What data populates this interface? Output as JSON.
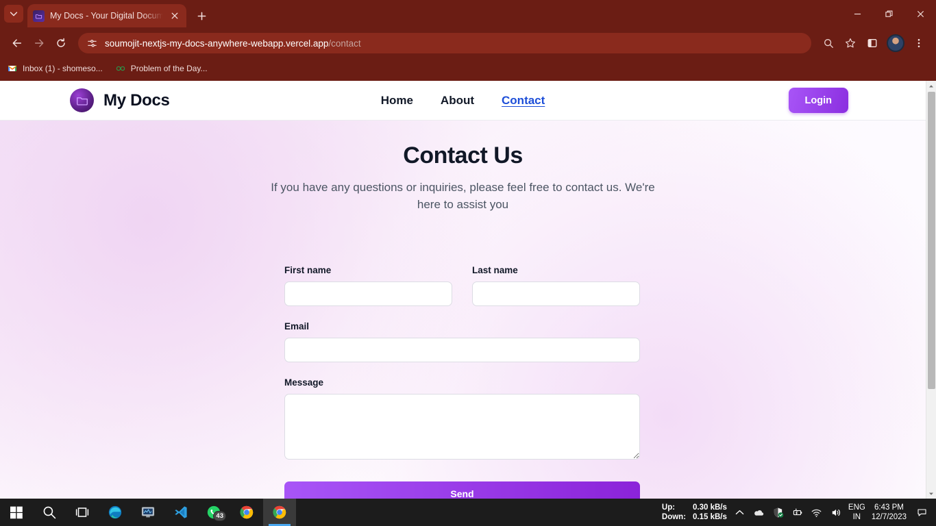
{
  "browser": {
    "tab": {
      "title": "My Docs - Your Digital Docume",
      "favicon_icon": "folder-favicon",
      "close_icon": "close-icon",
      "tab_list_icon": "chevron-down-icon",
      "new_tab_icon": "plus-icon"
    },
    "window_controls": {
      "minimize_icon": "minimize-icon",
      "restore_icon": "restore-icon",
      "close_icon": "close-icon"
    },
    "toolbar": {
      "back_icon": "back-arrow-icon",
      "forward_icon": "forward-arrow-icon",
      "reload_icon": "reload-icon",
      "site_info_icon": "site-settings-icon",
      "url_host": "soumojit-nextjs-my-docs-anywhere-webapp.vercel.app",
      "url_path": "/contact",
      "search_icon": "search-icon",
      "bookmark_icon": "star-icon",
      "side_panel_icon": "side-panel-icon",
      "profile_icon": "profile-avatar",
      "menu_icon": "three-dot-menu-icon"
    },
    "bookmarks": [
      {
        "label": "Inbox (1) - shomeso...",
        "icon": "gmail-icon"
      },
      {
        "label": "Problem of the Day...",
        "icon": "geeksforgeeks-icon"
      }
    ],
    "scrollbar": {
      "up_icon": "scroll-up-arrow-icon",
      "down_icon": "scroll-down-arrow-icon"
    }
  },
  "site": {
    "header": {
      "logo_icon": "folder-logo-icon",
      "brand": "My Docs",
      "nav": [
        {
          "label": "Home",
          "active": false
        },
        {
          "label": "About",
          "active": false
        },
        {
          "label": "Contact",
          "active": true
        }
      ],
      "login_label": "Login"
    },
    "hero": {
      "title": "Contact Us",
      "subtitle": "If you have any questions or inquiries, please feel free to contact us. We're here to assist you"
    },
    "form": {
      "first_name": {
        "label": "First name",
        "value": "",
        "placeholder": ""
      },
      "last_name": {
        "label": "Last name",
        "value": "",
        "placeholder": ""
      },
      "email": {
        "label": "Email",
        "value": "",
        "placeholder": ""
      },
      "message": {
        "label": "Message",
        "value": "",
        "placeholder": ""
      },
      "submit_label": "Send"
    },
    "colors": {
      "accent": "#8b2fe0",
      "accent_light": "#a855f7",
      "active_link": "#1d4ed8"
    }
  },
  "taskbar": {
    "items": [
      {
        "name": "start-button",
        "icon": "windows-icon"
      },
      {
        "name": "search-button",
        "icon": "search-icon"
      },
      {
        "name": "task-view-button",
        "icon": "task-view-icon"
      },
      {
        "name": "edge-button",
        "icon": "edge-icon"
      },
      {
        "name": "app-button",
        "icon": "monitor-app-icon"
      },
      {
        "name": "vscode-button",
        "icon": "vscode-icon"
      },
      {
        "name": "whatsapp-button",
        "icon": "whatsapp-icon",
        "badge": "43"
      },
      {
        "name": "chrome-button",
        "icon": "chrome-icon"
      },
      {
        "name": "chrome-active-button",
        "icon": "chrome-icon",
        "active": true
      }
    ],
    "tray": {
      "up_label": "Up:",
      "down_label": "Down:",
      "up_value": "0.30 kB/s",
      "down_value": "0.15 kB/s",
      "overflow_icon": "chevron-up-icon",
      "onedrive_icon": "onedrive-icon",
      "security_icon": "security-shield-icon",
      "battery_icon": "battery-charging-icon",
      "wifi_icon": "wifi-icon",
      "volume_icon": "volume-icon",
      "language": "ENG",
      "region": "IN",
      "time": "6:43 PM",
      "date": "12/7/2023",
      "notification_icon": "notification-icon"
    }
  }
}
